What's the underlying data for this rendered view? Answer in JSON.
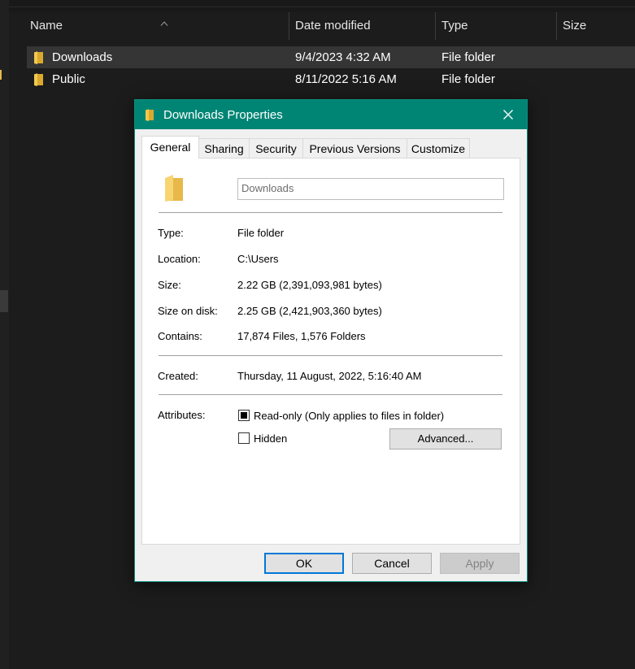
{
  "explorer": {
    "columns": {
      "name": "Name",
      "date": "Date modified",
      "type": "Type",
      "size": "Size"
    },
    "rows": [
      {
        "name": "Downloads",
        "date": "9/4/2023 4:32 AM",
        "type": "File folder"
      },
      {
        "name": "Public",
        "date": "8/11/2022 5:16 AM",
        "type": "File folder"
      }
    ]
  },
  "dialog": {
    "title": "Downloads Properties",
    "tabs": [
      "General",
      "Sharing",
      "Security",
      "Previous Versions",
      "Customize"
    ],
    "general": {
      "folder_name": "Downloads",
      "type_label": "Type:",
      "type_value": "File folder",
      "location_label": "Location:",
      "location_value": "C:\\Users",
      "size_label": "Size:",
      "size_value": "2.22 GB (2,391,093,981 bytes)",
      "size_on_disk_label": "Size on disk:",
      "size_on_disk_value": "2.25 GB (2,421,903,360 bytes)",
      "contains_label": "Contains:",
      "contains_value": "17,874 Files, 1,576 Folders",
      "created_label": "Created:",
      "created_value": "Thursday, 11 August, 2022, 5:16:40 AM",
      "attributes_label": "Attributes:",
      "readonly_label": "Read-only (Only applies to files in folder)",
      "hidden_label": "Hidden",
      "advanced_label": "Advanced..."
    },
    "buttons": {
      "ok": "OK",
      "cancel": "Cancel",
      "apply": "Apply"
    }
  },
  "colors": {
    "titlebar": "#008575",
    "folder": "#f4c84e",
    "explorer_bg": "#1c1c1c",
    "selected_row": "#353535"
  }
}
